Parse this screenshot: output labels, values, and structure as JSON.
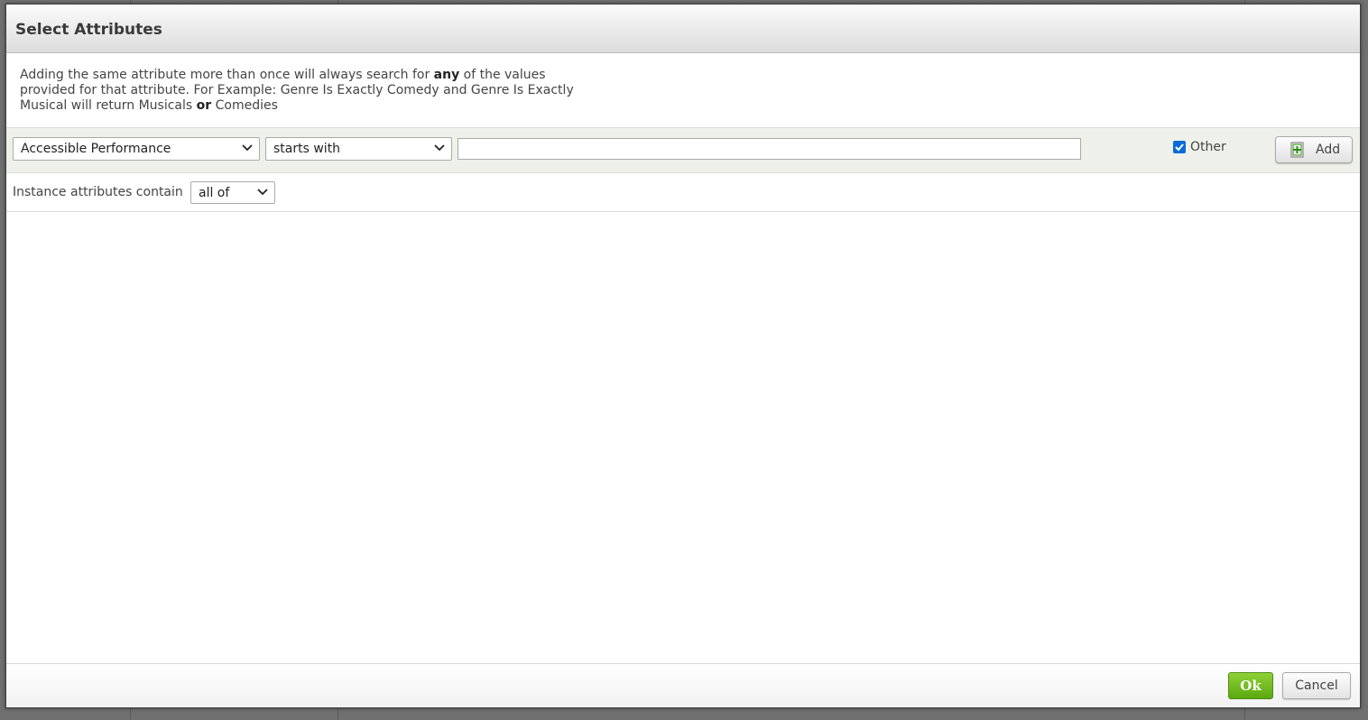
{
  "dialog": {
    "title": "Select Attributes"
  },
  "note": {
    "part1": "Adding the same attribute more than once will always search for ",
    "bold1": "any",
    "part2": " of the values provided for that attribute. For Example: Genre Is Exactly Comedy and Genre Is Exactly Musical will return Musicals ",
    "bold2": "or",
    "part3": " Comedies"
  },
  "attribute_row": {
    "attribute_select": "Accessible Performance",
    "operator_select": "starts with",
    "value_input": "",
    "other_checkbox": {
      "label": "Other",
      "checked": true
    },
    "add_button": "Add"
  },
  "instance_row": {
    "label": "Instance attributes contain",
    "match_select": "all of"
  },
  "footer": {
    "ok_label": "Ok",
    "cancel_label": "Cancel"
  },
  "colors": {
    "ok_green": "#6bbd1c",
    "checkbox_blue": "#0a6bd6",
    "row_bg": "#eef1e9"
  },
  "icons": {
    "dropdown": "chevron-down-icon",
    "add": "plus-document-icon",
    "check": "checkmark-icon"
  }
}
